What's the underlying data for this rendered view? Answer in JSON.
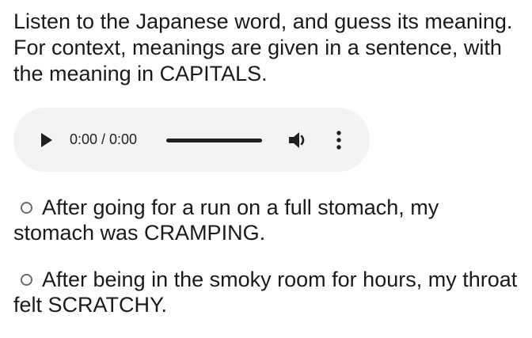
{
  "instructions": "Listen to the Japanese word, and guess its meaning. For context, meanings are given in a sentence, with the meaning in CAPITALS.",
  "audio": {
    "time_display": "0:00 / 0:00",
    "play_icon": "play-icon",
    "volume_icon": "volume-icon",
    "menu_icon": "more-vert-icon",
    "background_color": "#f1f3f4",
    "progress": 0
  },
  "options": [
    {
      "label": "After going for a run on a full stomach, my stomach was CRAMPING.",
      "selected": false
    },
    {
      "label": "After being in the smoky room for hours, my throat felt SCRATCHY.",
      "selected": false
    }
  ]
}
